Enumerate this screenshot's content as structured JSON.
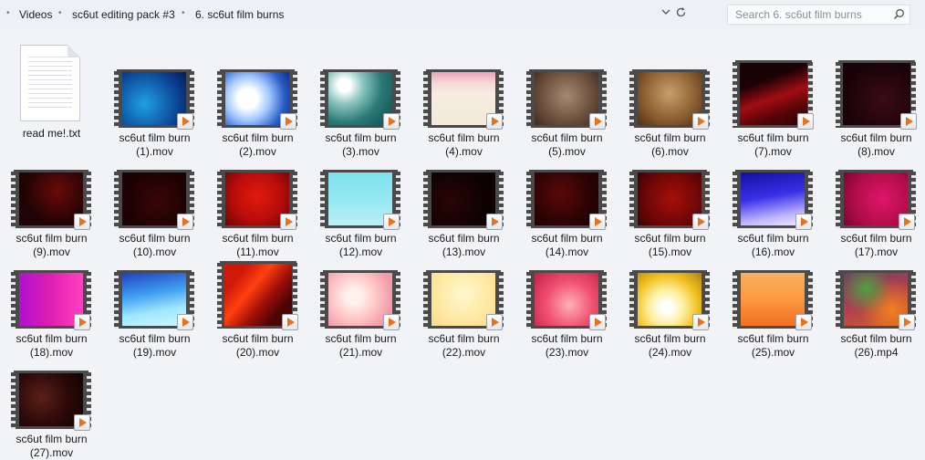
{
  "breadcrumb": [
    "Videos",
    "sc6ut editing pack #3",
    "6. sc6ut film burns"
  ],
  "search": {
    "placeholder": "Search 6. sc6ut film burns",
    "value": ""
  },
  "files": [
    {
      "name_line1": "read me!.txt",
      "name_line2": "",
      "kind": "text-document"
    },
    {
      "name_line1": "sc6ut film burn",
      "name_line2": "(1).mov",
      "kind": "video"
    },
    {
      "name_line1": "sc6ut film burn",
      "name_line2": "(2).mov",
      "kind": "video"
    },
    {
      "name_line1": "sc6ut film burn",
      "name_line2": "(3).mov",
      "kind": "video"
    },
    {
      "name_line1": "sc6ut film burn",
      "name_line2": "(4).mov",
      "kind": "video"
    },
    {
      "name_line1": "sc6ut film burn",
      "name_line2": "(5).mov",
      "kind": "video"
    },
    {
      "name_line1": "sc6ut film burn",
      "name_line2": "(6).mov",
      "kind": "video"
    },
    {
      "name_line1": "sc6ut film burn",
      "name_line2": "(7).mov",
      "kind": "video"
    },
    {
      "name_line1": "sc6ut film burn",
      "name_line2": "(8).mov",
      "kind": "video"
    },
    {
      "name_line1": "sc6ut film burn",
      "name_line2": "(9).mov",
      "kind": "video"
    },
    {
      "name_line1": "sc6ut film burn",
      "name_line2": "(10).mov",
      "kind": "video"
    },
    {
      "name_line1": "sc6ut film burn",
      "name_line2": "(11).mov",
      "kind": "video"
    },
    {
      "name_line1": "sc6ut film burn",
      "name_line2": "(12).mov",
      "kind": "video"
    },
    {
      "name_line1": "sc6ut film burn",
      "name_line2": "(13).mov",
      "kind": "video"
    },
    {
      "name_line1": "sc6ut film burn",
      "name_line2": "(14).mov",
      "kind": "video"
    },
    {
      "name_line1": "sc6ut film burn",
      "name_line2": "(15).mov",
      "kind": "video"
    },
    {
      "name_line1": "sc6ut film burn",
      "name_line2": "(16).mov",
      "kind": "video"
    },
    {
      "name_line1": "sc6ut film burn",
      "name_line2": "(17).mov",
      "kind": "video"
    },
    {
      "name_line1": "sc6ut film burn",
      "name_line2": "(18).mov",
      "kind": "video"
    },
    {
      "name_line1": "sc6ut film burn",
      "name_line2": "(19).mov",
      "kind": "video"
    },
    {
      "name_line1": "sc6ut film burn",
      "name_line2": "(20).mov",
      "kind": "video"
    },
    {
      "name_line1": "sc6ut film burn",
      "name_line2": "(21).mov",
      "kind": "video"
    },
    {
      "name_line1": "sc6ut film burn",
      "name_line2": "(22).mov",
      "kind": "video"
    },
    {
      "name_line1": "sc6ut film burn",
      "name_line2": "(23).mov",
      "kind": "video"
    },
    {
      "name_line1": "sc6ut film burn",
      "name_line2": "(24).mov",
      "kind": "video"
    },
    {
      "name_line1": "sc6ut film burn",
      "name_line2": "(25).mov",
      "kind": "video"
    },
    {
      "name_line1": "sc6ut film burn",
      "name_line2": "(26).mp4",
      "kind": "video"
    },
    {
      "name_line1": "sc6ut film burn",
      "name_line2": "(27).mov",
      "kind": "video"
    }
  ],
  "icons": {
    "dropdown": "chevron-down-icon",
    "refresh": "refresh-icon",
    "search": "search-icon",
    "video_badge": "video-play-badge-icon",
    "text_file": "text-document-icon"
  }
}
